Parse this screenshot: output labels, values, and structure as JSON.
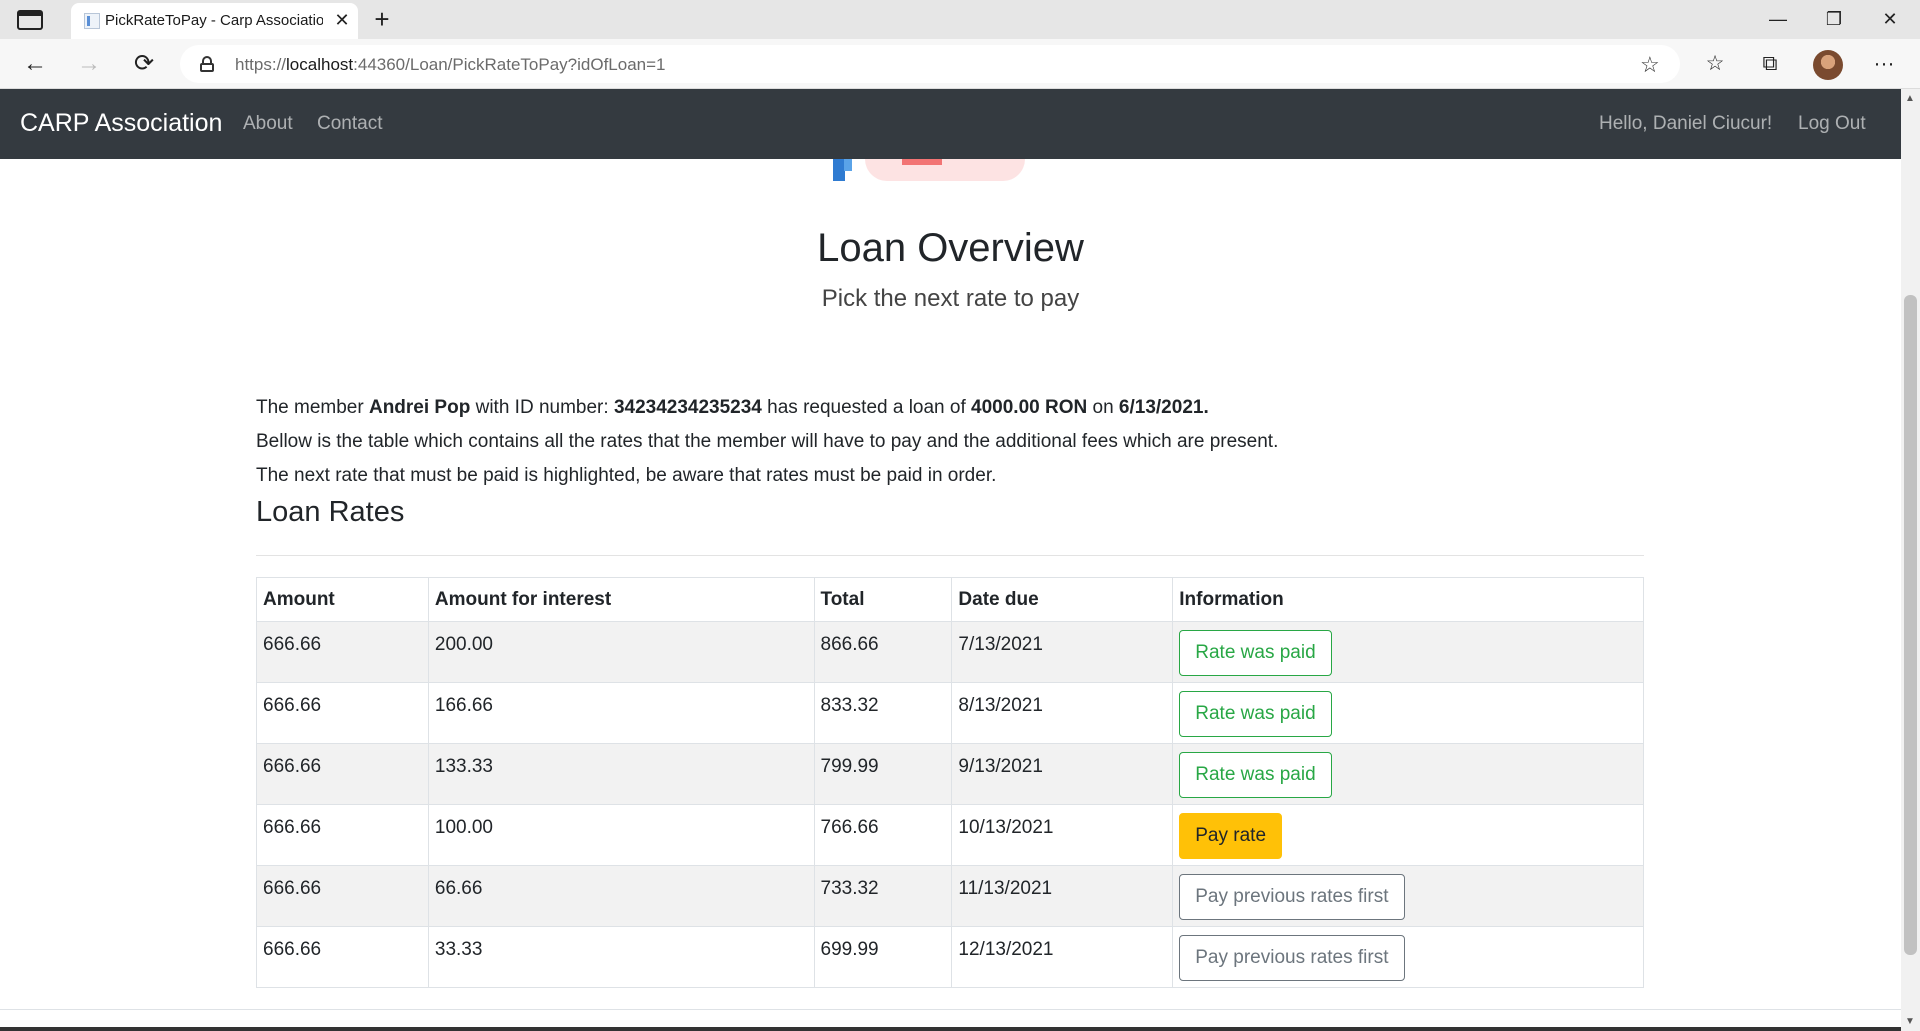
{
  "browser": {
    "tab_title": "PickRateToPay - Carp Association",
    "tab_close": "✕",
    "new_tab": "+",
    "url_prefix": "https://",
    "url_host": "localhost",
    "url_rest": ":44360/Loan/PickRateToPay?idOfLoan=1",
    "minimize": "—",
    "restore": "❐",
    "close": "✕",
    "back": "←",
    "forward": "→",
    "reload": "⟳",
    "favorites_add": "☆",
    "favorites": "☆",
    "collections": "⧉",
    "more": "···"
  },
  "navbar": {
    "brand": "CARP Association",
    "links": [
      "About",
      "Contact"
    ],
    "greeting": "Hello, Daniel Ciucur!",
    "logout": "Log Out"
  },
  "header": {
    "title": "Loan Overview",
    "subtitle": "Pick the next rate to pay"
  },
  "loan_info": {
    "prefix": "The member ",
    "member_name": "Andrei Pop",
    "id_label": " with ID number: ",
    "id_number": "34234234235234",
    "requested_label": " has requested a loan of ",
    "amount": "4000.00 RON",
    "on_label": " on ",
    "date": "6/13/2021",
    "period": ".",
    "line2": "Bellow is the table which contains all the rates that the member will have to pay and the additional fees which are present.",
    "line3": "The next rate that must be paid is highlighted, be aware that rates must be paid in order."
  },
  "rates": {
    "section_title": "Loan Rates",
    "columns": [
      "Amount",
      "Amount for interest",
      "Total",
      "Date due",
      "Information"
    ],
    "rows": [
      {
        "amount": "666.66",
        "interest": "200.00",
        "total": "866.66",
        "date_due": "7/13/2021",
        "action": "Rate was paid",
        "status": "paid"
      },
      {
        "amount": "666.66",
        "interest": "166.66",
        "total": "833.32",
        "date_due": "8/13/2021",
        "action": "Rate was paid",
        "status": "paid"
      },
      {
        "amount": "666.66",
        "interest": "133.33",
        "total": "799.99",
        "date_due": "9/13/2021",
        "action": "Rate was paid",
        "status": "paid"
      },
      {
        "amount": "666.66",
        "interest": "100.00",
        "total": "766.66",
        "date_due": "10/13/2021",
        "action": "Pay rate",
        "status": "next"
      },
      {
        "amount": "666.66",
        "interest": "66.66",
        "total": "733.32",
        "date_due": "11/13/2021",
        "action": "Pay previous rates first",
        "status": "locked"
      },
      {
        "amount": "666.66",
        "interest": "33.33",
        "total": "699.99",
        "date_due": "12/13/2021",
        "action": "Pay previous rates first",
        "status": "locked"
      }
    ]
  },
  "colors": {
    "navbar_bg": "#343a40",
    "paid": "#28a745",
    "next": "#ffc107",
    "locked": "#6c757d"
  }
}
